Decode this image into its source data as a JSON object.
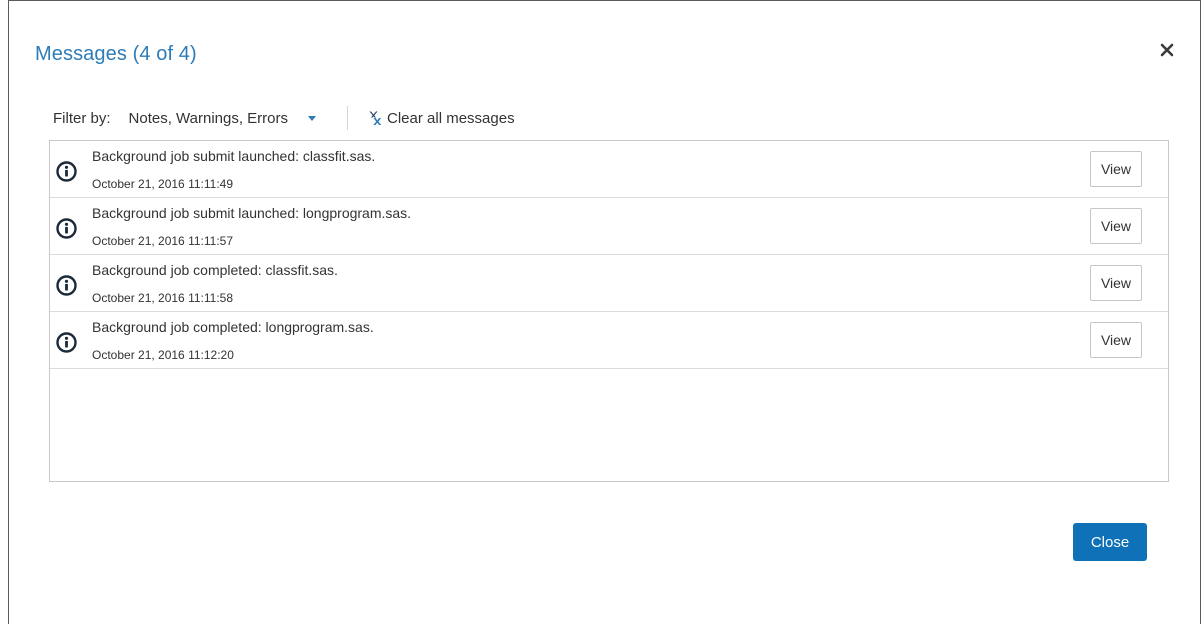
{
  "dialog": {
    "title": "Messages (4 of 4)",
    "close_icon": "close-icon"
  },
  "filter": {
    "label": "Filter by:",
    "selected": "Notes, Warnings, Errors",
    "caret_icon": "caret-down-icon",
    "clear_label": "Clear all messages",
    "clear_icon": "clear-messages-icon"
  },
  "messages": [
    {
      "icon": "info-icon",
      "text": "Background job submit launched: classfit.sas.",
      "timestamp": "October 21, 2016 11:11:49",
      "view_label": "View"
    },
    {
      "icon": "info-icon",
      "text": "Background job submit launched: longprogram.sas.",
      "timestamp": "October 21, 2016 11:11:57",
      "view_label": "View"
    },
    {
      "icon": "info-icon",
      "text": "Background job completed: classfit.sas.",
      "timestamp": "October 21, 2016 11:11:58",
      "view_label": "View"
    },
    {
      "icon": "info-icon",
      "text": "Background job completed: longprogram.sas.",
      "timestamp": "October 21, 2016 11:12:20",
      "view_label": "View"
    }
  ],
  "footer": {
    "close_label": "Close"
  },
  "colors": {
    "title": "#2d7cb8",
    "primary_button": "#0f72b8",
    "icon": "#1a2a3a"
  }
}
